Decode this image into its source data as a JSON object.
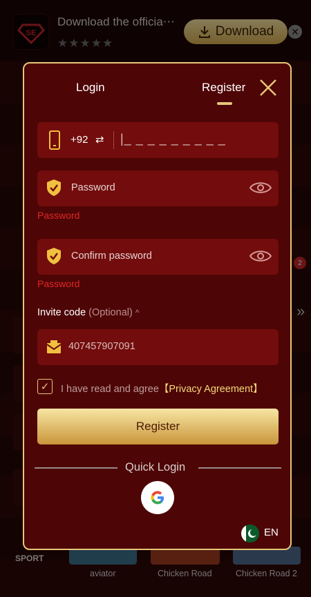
{
  "banner": {
    "app_name": "Download the officia⋯",
    "stars": "★★★★★",
    "download_label": "Download"
  },
  "background": {
    "side_label": "SPORT",
    "games": [
      "aviator",
      "Chicken Road",
      "Chicken Road 2"
    ],
    "badge": "2"
  },
  "modal": {
    "tabs": {
      "login": "Login",
      "register": "Register"
    },
    "phone": {
      "country_code": "+92",
      "swap_glyph": "⇄",
      "mask": "|_ _ _ _ _ _ _ _ _"
    },
    "password": {
      "label": "Password",
      "error": "Password"
    },
    "confirm": {
      "label": "Confirm password",
      "error": "Password"
    },
    "invite": {
      "label": "Invite code",
      "optional": "(Optional)",
      "caret": "^",
      "value": "407457907091"
    },
    "agreement": {
      "text": "I have read and agree",
      "link": "【Privacy Agreement】",
      "checked": true
    },
    "register_label": "Register",
    "quick_login": "Quick Login",
    "language": "EN",
    "colors": {
      "accent": "#e6c77a",
      "panel": "#4e0505",
      "field": "#730c0c",
      "error": "#e02727"
    }
  }
}
